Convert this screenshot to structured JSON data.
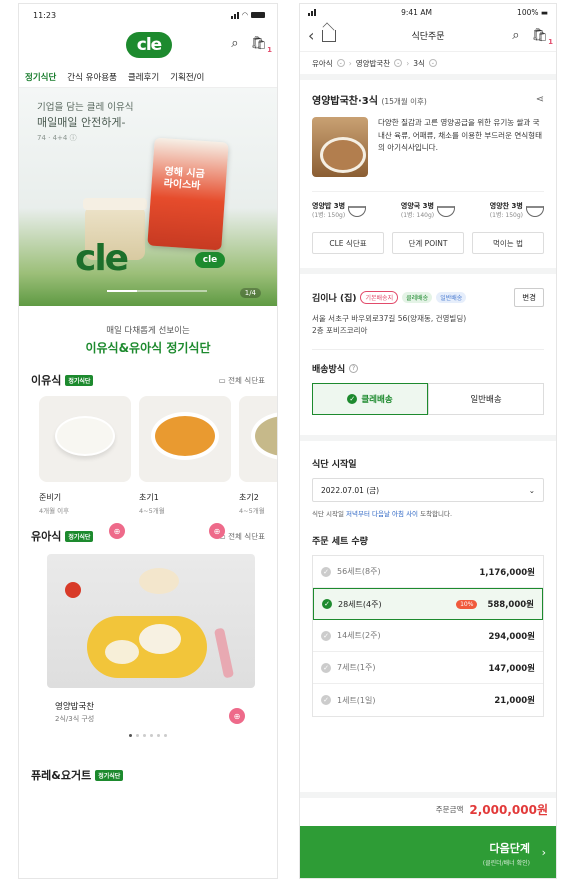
{
  "left": {
    "status_time": "11:23",
    "logo": "cle",
    "categories": [
      "정기식단",
      "간식 유아용품",
      "클레후기",
      "기획전/이"
    ],
    "banner": {
      "line1": "기업을 담는 클레 이유식",
      "line2": "매일매일 안전하게-",
      "small": "74 · 4+4 ⓘ",
      "pouch_label": "영해 시금\n라이스바",
      "big_logo": "cle",
      "mini_logo": "cle",
      "pager": "1/4"
    },
    "promo": {
      "sub": "매일 다채롭게 선보이는",
      "main": "이유식&유아식 정기식단"
    },
    "sections": {
      "baby_food": {
        "title": "이유식",
        "tag": "정기식단",
        "more": "전체 식단표"
      },
      "toddler_food": {
        "title": "유아식",
        "tag": "정기식단",
        "more": "전체 식단표"
      },
      "puree": {
        "title": "퓨레&요거트",
        "tag": "정기식단"
      }
    },
    "baby_cards": [
      {
        "name": "준비기",
        "sub": "4개월 이후",
        "color": "#f7f6f1"
      },
      {
        "name": "초기1",
        "sub": "4~5개월",
        "color": "#e99a30"
      },
      {
        "name": "초기2",
        "sub": "4~5개월",
        "color": "#c6b98a"
      }
    ],
    "toddler_product": {
      "name": "영양밥국찬",
      "sub": "2식/3식 구성"
    }
  },
  "right": {
    "status_time": "9:41 AM",
    "status_battery": "100%",
    "nav_title": "식단주문",
    "breadcrumb": [
      "유아식",
      "영양밥국찬",
      "3식"
    ],
    "product": {
      "title": "영양밥국찬·3식",
      "age": "(15개월 이후)",
      "desc": "다양한 질감과 고른 영양공급을 위한 유기농 쌀과 국내산 육류, 어패류, 채소를 이용한 부드러운 연식형태의 아기식사입니다.",
      "options": [
        {
          "name": "영양밥 3병",
          "size": "(1병: 150g)"
        },
        {
          "name": "영양국 3병",
          "size": "(1병: 140g)"
        },
        {
          "name": "영양찬 3병",
          "size": "(1병: 150g)"
        }
      ],
      "buttons": [
        "CLE 식단표",
        "단계 POINT",
        "먹이는 법"
      ]
    },
    "address": {
      "name": "김이나 (집)",
      "tag_default": "기본배송지",
      "tag_cle": "클레배송",
      "tag_normal": "일반배송",
      "change": "변경",
      "line1": "서울 서초구 바우뫼로37길 56(양재동, 건영빌딩)",
      "line2": "2층 포비즈코리아"
    },
    "delivery": {
      "label": "배송방식",
      "options": [
        "클레배송",
        "일반배송"
      ],
      "selected": "클레배송"
    },
    "start": {
      "label": "식단 시작일",
      "date": "2022.07.01 (금)",
      "note_prefix": "식단 시작일 ",
      "note_highlight": "저녁부터 다음날 아침 사이",
      "note_suffix": " 도착합니다."
    },
    "quantity": {
      "label": "주문 세트 수량",
      "rows": [
        {
          "label": "56세트(8주)",
          "price": "1,176,000원"
        },
        {
          "label": "28세트(4주)",
          "price": "588,000원",
          "discount": "10%"
        },
        {
          "label": "14세트(2주)",
          "price": "294,000원"
        },
        {
          "label": "7세트(1주)",
          "price": "147,000원"
        },
        {
          "label": "1세트(1일)",
          "price": "21,000원"
        }
      ]
    },
    "total": {
      "label": "주문금액",
      "amount": "2,000,000원"
    },
    "cta": {
      "main": "다음단계",
      "sub": "(클린더/배너 확인)"
    }
  }
}
